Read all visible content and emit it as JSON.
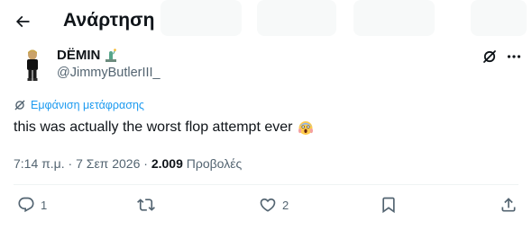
{
  "header": {
    "title": "Ανάρτηση",
    "back_icon": "arrow-left-icon"
  },
  "author": {
    "display_name": "DËMIN",
    "badge_icon": "statue-of-liberty-emoji",
    "handle": "@JimmyButlerIII_"
  },
  "post": {
    "translate_label": "Εμφάνιση μετάφρασης",
    "text": "this was actually the worst flop attempt ever",
    "emoji": "face-screaming-in-fear-emoji",
    "time": "7:14 π.μ.",
    "separator": "·",
    "date": "7 Σεπ 2026",
    "views_count": "2.009",
    "views_label": "Προβολές"
  },
  "actions": {
    "replies": "1",
    "reposts": "",
    "likes": "2"
  },
  "colors": {
    "accent": "#1d9bf0",
    "secondary_text": "#536471",
    "primary_text": "#0f1419",
    "divider": "#eff3f4"
  }
}
